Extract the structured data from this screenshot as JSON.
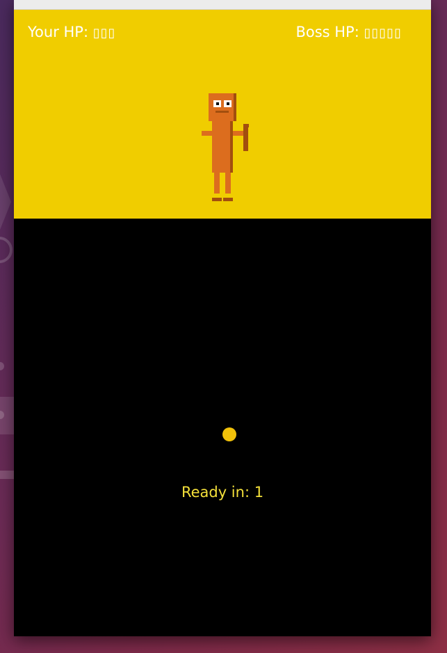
{
  "hud": {
    "player_hp_label": "Your HP:",
    "player_hp_value": "▯▯▯",
    "boss_hp_label": "Boss HP:",
    "boss_hp_value": "▯▯▯▯▯"
  },
  "status": {
    "text": "Ready in: 1"
  },
  "colors": {
    "arena_bg": "#f0cd00",
    "field_bg": "#000000",
    "hud_text": "#ffffff",
    "status_text": "#f4e03a",
    "player_dot": "#f2c20a",
    "boss_body": "#dc6d1e",
    "boss_shadow": "#a24e0e"
  }
}
